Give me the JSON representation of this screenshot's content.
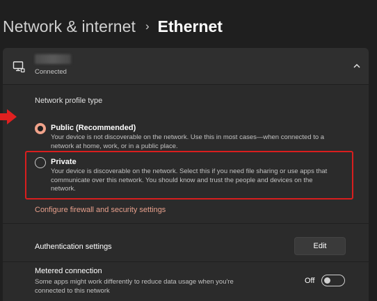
{
  "breadcrumb": {
    "parent": "Network & internet",
    "separator": "›",
    "current": "Ethernet"
  },
  "connection": {
    "icon": "ethernet-monitor-icon",
    "status": "Connected",
    "expand_icon": "chevron-up-icon"
  },
  "profile": {
    "section_label": "Network profile type",
    "options": [
      {
        "title": "Public (Recommended)",
        "description": "Your device is not discoverable on the network. Use this in most cases—when connected to a network at home, work, or in a public place.",
        "selected": true
      },
      {
        "title": "Private",
        "description": "Your device is discoverable on the network. Select this if you need file sharing or use apps that communicate over this network. You should know and trust the people and devices on the network.",
        "selected": false
      }
    ]
  },
  "firewall_link": "Configure firewall and security settings",
  "authentication": {
    "label": "Authentication settings",
    "button": "Edit"
  },
  "metered": {
    "title": "Metered connection",
    "description": "Some apps might work differently to reduce data usage when you're connected to this network",
    "state": "Off",
    "enabled": false
  },
  "colors": {
    "accent": "#f0a28a",
    "link": "#e7a08c",
    "highlight": "#d91e1e",
    "background": "#1f1f1f",
    "card": "#2b2b2b"
  }
}
